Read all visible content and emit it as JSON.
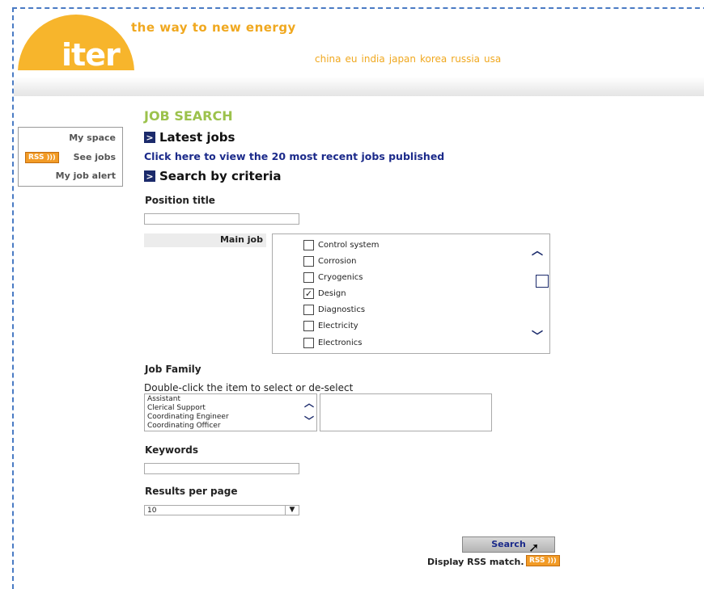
{
  "header": {
    "logo_text": "iter",
    "tagline": "the way to new energy",
    "countries": [
      "china",
      "eu",
      "india",
      "japan",
      "korea",
      "russia",
      "usa"
    ]
  },
  "sidebar": {
    "items": [
      {
        "label": "My space"
      },
      {
        "label": "See jobs",
        "badge": "RSS"
      },
      {
        "label": "My job alert"
      }
    ]
  },
  "main": {
    "title": "JOB SEARCH",
    "latest_heading": "Latest jobs",
    "latest_link": "Click here to view the 20 most recent jobs published",
    "criteria_heading": "Search by criteria",
    "position_label": "Position title",
    "position_value": "",
    "main_job_label": "Main job",
    "main_job_options": [
      {
        "label": "Control system",
        "checked": false
      },
      {
        "label": "Corrosion",
        "checked": false
      },
      {
        "label": "Cryogenics",
        "checked": false
      },
      {
        "label": "Design",
        "checked": true
      },
      {
        "label": "Diagnostics",
        "checked": false
      },
      {
        "label": "Electricity",
        "checked": false
      },
      {
        "label": "Electronics",
        "checked": false
      }
    ],
    "job_family_label": "Job Family",
    "job_family_hint": "Double-click the item to select or de-select",
    "job_family_options": [
      "Assistant",
      "Clerical Support",
      "Coordinating Engineer",
      "Coordinating Officer"
    ],
    "keywords_label": "Keywords",
    "keywords_value": "",
    "results_label": "Results per page",
    "results_value": "10",
    "search_button": "Search",
    "rss_text": "Display RSS match.",
    "rss_badge": "RSS"
  },
  "colors": {
    "brand_orange": "#f7b52c",
    "title_green": "#9cc24c",
    "link_blue": "#1b2a8a"
  }
}
